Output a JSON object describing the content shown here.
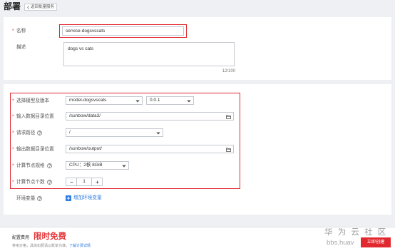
{
  "page": {
    "title": "部署",
    "back_label": "返回批量服务"
  },
  "required_mark": "*",
  "basic": {
    "name": {
      "label": "名称",
      "value": "service-dogsvscats"
    },
    "description": {
      "label": "描述",
      "value": "dogs vs cats",
      "counter": "12/100"
    }
  },
  "config": {
    "model": {
      "label": "选择模型及版本",
      "model_value": "model-dogsvscats",
      "version_value": "0.0.1"
    },
    "input_dir": {
      "label": "输入数据目录位置",
      "value": "/sunbow/data3/"
    },
    "request_path": {
      "label": "请求路径",
      "value": "/"
    },
    "output_dir": {
      "label": "输出数据目录位置",
      "value": "/sunbow/output/"
    },
    "compute_spec": {
      "label": "计算节点规格",
      "value": "CPU：2核 8GiB"
    },
    "compute_count": {
      "label": "计算节点个数",
      "value": "1"
    },
    "env": {
      "label": "环境变量",
      "add_label": "增加环境变量"
    }
  },
  "footer": {
    "fee_label": "配置费用",
    "fee_value": "限时免费",
    "note": "参考价格，具体扣费请以账单为准。",
    "note_link": "了解计费详情",
    "create_label": "立即创建"
  },
  "watermark": {
    "name": "华 为 云 社 区",
    "url": "bbs.huav"
  },
  "icons": {
    "back": "chevron-left-icon",
    "help": "question-circle-icon",
    "dropdown": "chevron-down-icon",
    "folder": "folder-icon",
    "minus": "minus-icon",
    "plus": "plus-icon",
    "add": "plus-square-icon"
  },
  "colors": {
    "required": "#e1262d",
    "link": "#2a7ae2",
    "primary_button": "#e0282e",
    "free_text": "#e4393c"
  }
}
